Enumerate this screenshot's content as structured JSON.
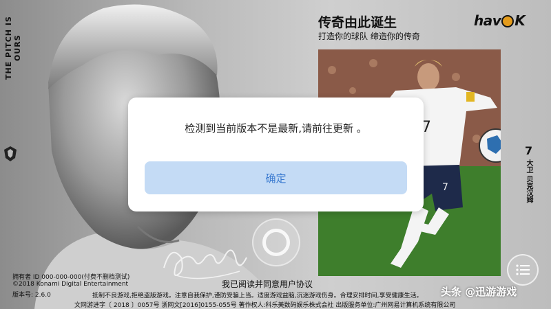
{
  "left_vertical_text": "THE PITCH IS OURS",
  "header": {
    "title": "传奇由此诞生",
    "subtitle": "打造你的球队  缔造你的传奇",
    "logo_text_left": "hav",
    "logo_text_right": "K"
  },
  "side": {
    "number": "7",
    "name": "大卫 贝克汉姆"
  },
  "dialog": {
    "message": "检测到当前版本不是最新,请前往更新 。",
    "confirm_label": "确定"
  },
  "info": {
    "owner": "拥有者 ID 000-000-000(付费不删档测试)",
    "copyright": "©2018 Konami Digital Entertainment",
    "version": "版本号: 2.6.0"
  },
  "agreement": "我已阅读并同意用户协议",
  "footer": {
    "line1": "抵制不良游戏,拒绝盗版游戏。注意自我保护,谨防受骗上当。适度游戏益脑,沉迷游戏伤身。合理安排时间,享受健康生活。",
    "line2": "文网游进字〔 2018 〕0057号 浙网文[2016]0155-055号 著作权人:科乐美数码娱乐株式会社 出版服务单位:广州网易计算机系统有限公司"
  },
  "watermark": "头条 @迅游游戏",
  "colors": {
    "dialog_button_bg": "#c4dbf5",
    "dialog_button_text": "#3a7ad0",
    "logo_accent": "#e39b1c"
  },
  "icons": [
    "crest-icon",
    "home-circle-icon",
    "menu-list-icon",
    "signature-graphic"
  ]
}
